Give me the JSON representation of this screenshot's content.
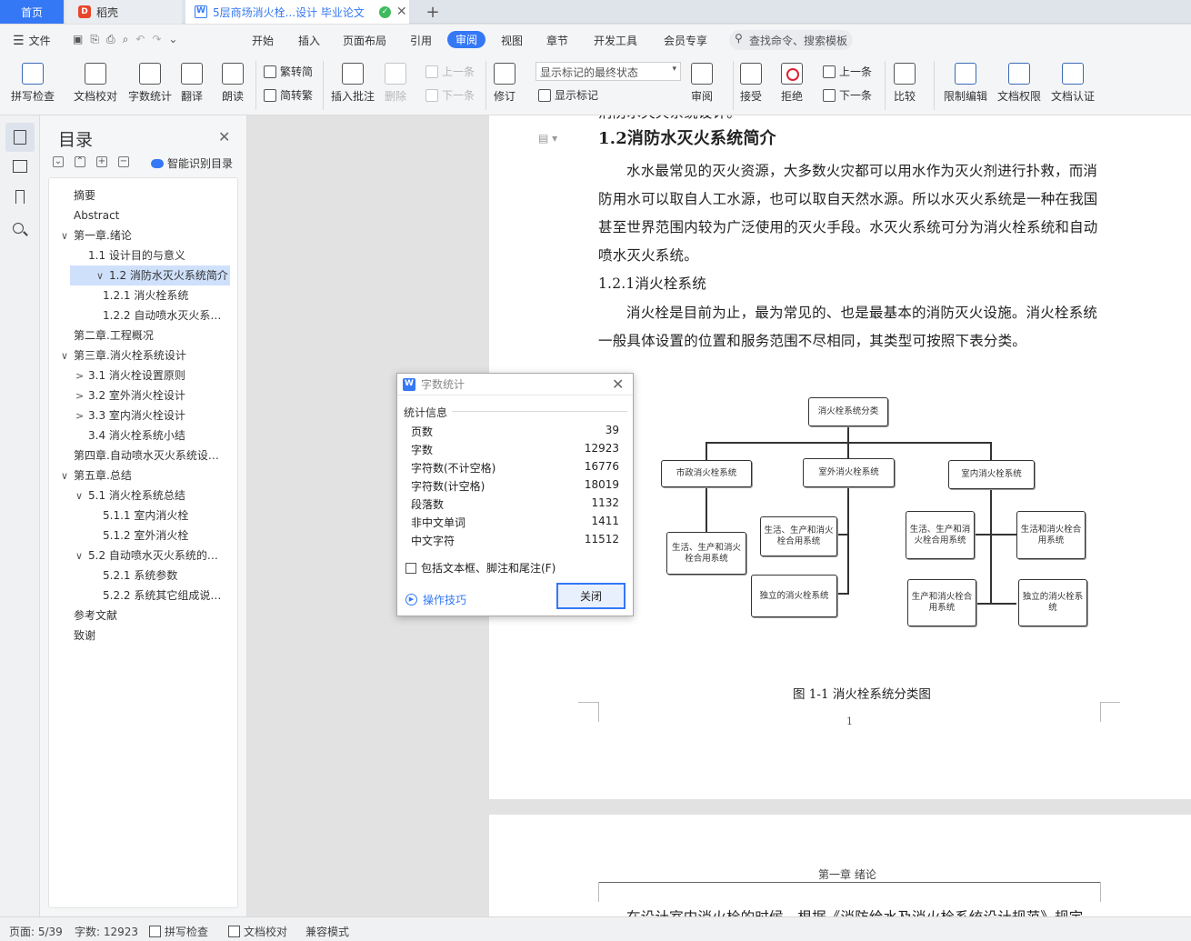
{
  "tabs": {
    "home": "首页",
    "daoke": "稻壳",
    "doc_title": "5层商场消火栓...设计 毕业论文",
    "add": "+"
  },
  "menu": {
    "file": "文件",
    "items": [
      "开始",
      "插入",
      "页面布局",
      "引用",
      "审阅",
      "视图",
      "章节",
      "开发工具",
      "会员专享"
    ],
    "active": "审阅",
    "search": "查找命令、搜索模板"
  },
  "ribbon": {
    "spellcheck": "拼写检查",
    "doc_proof": "文档校对",
    "word_count": "字数统计",
    "translate": "翻译",
    "read_aloud": "朗读",
    "trad_to_simp": "繁转简",
    "simp_to_trad": "简转繁",
    "insert_comment": "插入批注",
    "delete": "删除",
    "prev_comment": "上一条",
    "next_comment": "下一条",
    "track_changes": "修订",
    "markup_mode": "显示标记的最终状态",
    "show_markup": "显示标记",
    "review": "审阅",
    "accept": "接受",
    "reject": "拒绝",
    "prev_change": "上一条",
    "next_change": "下一条",
    "compare": "比较",
    "restrict_edit": "限制编辑",
    "doc_permission": "文档权限",
    "doc_certify": "文档认证"
  },
  "toc": {
    "title": "目录",
    "ai_label": "智能识别目录",
    "items": [
      {
        "label": "摘要",
        "arrow": ""
      },
      {
        "label": "Abstract",
        "arrow": ""
      },
      {
        "label": "第一章.绪论",
        "arrow": "∨"
      },
      {
        "label": "1.1 设计目的与意义",
        "arrow": ""
      },
      {
        "label": "1.2 消防水灭火系统简介",
        "arrow": "∨"
      },
      {
        "label": "1.2.1 消火栓系统",
        "arrow": ""
      },
      {
        "label": "1.2.2 自动喷水灭火系…",
        "arrow": ""
      },
      {
        "label": "第二章.工程概况",
        "arrow": ""
      },
      {
        "label": "第三章.消火栓系统设计",
        "arrow": "∨"
      },
      {
        "label": "3.1 消火栓设置原则",
        "arrow": ">"
      },
      {
        "label": "3.2 室外消火栓设计",
        "arrow": ">"
      },
      {
        "label": "3.3 室内消火栓设计",
        "arrow": ">"
      },
      {
        "label": "3.4 消火栓系统小结",
        "arrow": ""
      },
      {
        "label": "第四章.自动喷水灭火系统设…",
        "arrow": ""
      },
      {
        "label": "第五章.总结",
        "arrow": "∨"
      },
      {
        "label": "5.1 消火栓系统总结",
        "arrow": "∨"
      },
      {
        "label": "5.1.1 室内消火栓",
        "arrow": ""
      },
      {
        "label": "5.1.2 室外消火栓",
        "arrow": ""
      },
      {
        "label": "5.2 自动喷水灭火系统的…",
        "arrow": "∨"
      },
      {
        "label": "5.2.1 系统参数",
        "arrow": ""
      },
      {
        "label": "5.2.2 系统其它组成说…",
        "arrow": ""
      },
      {
        "label": "参考文献",
        "arrow": ""
      },
      {
        "label": "致谢",
        "arrow": ""
      }
    ]
  },
  "doc": {
    "top_partial": "消防水灭火系统设计。",
    "heading": "1.2消防水灭火系统简介",
    "para1": [
      "水水最常见的灭火资源，大多数火灾都可以用水作为灭火剂进行扑救，而消",
      "防用水可以取自人工水源，也可以取自天然水源。所以水灭火系统是一种在我国",
      "甚至世界范围内较为广泛使用的灭火手段。水灭火系统可分为消火栓系统和自动",
      "喷水灭火系统。"
    ],
    "subheading": "1.2.1消火栓系统",
    "para2": [
      "消火栓是目前为止，最为常见的、也是最基本的消防灭火设施。消火栓系统",
      "一般具体设置的位置和服务范围不尽相同，其类型可按照下表分类。"
    ],
    "caption": "图 1-1 消火栓系统分类图",
    "page_number": "1",
    "page2_header": "第一章 绪论",
    "page2_partial": "在设计室内消火栓的时候，根据《消防给水及消火栓系统设计规范》规定"
  },
  "diagram": {
    "root": "消火栓系统分类",
    "municipal": "市政消火栓系统",
    "outdoor": "室外消火栓系统",
    "indoor": "室内消火栓系统",
    "mun_child": "生活、生产和消火栓合用系统",
    "out_child1": "生活、生产和消火栓合用系统",
    "out_child2": "独立的消火栓系统",
    "in_child1": "生活、生产和消火栓合用系统",
    "in_child2": "生活和消火栓合用系统",
    "in_child3": "生产和消火栓合用系统",
    "in_child4": "独立的消火栓系统"
  },
  "dialog": {
    "title": "字数统计",
    "section": "统计信息",
    "stats": [
      {
        "label": "页数",
        "value": "39"
      },
      {
        "label": "字数",
        "value": "12923"
      },
      {
        "label": "字符数(不计空格)",
        "value": "16776"
      },
      {
        "label": "字符数(计空格)",
        "value": "18019"
      },
      {
        "label": "段落数",
        "value": "1132"
      },
      {
        "label": "非中文单词",
        "value": "1411"
      },
      {
        "label": "中文字符",
        "value": "11512"
      }
    ],
    "checkbox": "包括文本框、脚注和尾注(F)",
    "tips": "操作技巧",
    "close": "关闭"
  },
  "status": {
    "page": "页面: 5/39",
    "words": "字数: 12923",
    "spell": "拼写检查",
    "proof": "文档校对",
    "compat": "兼容模式"
  }
}
